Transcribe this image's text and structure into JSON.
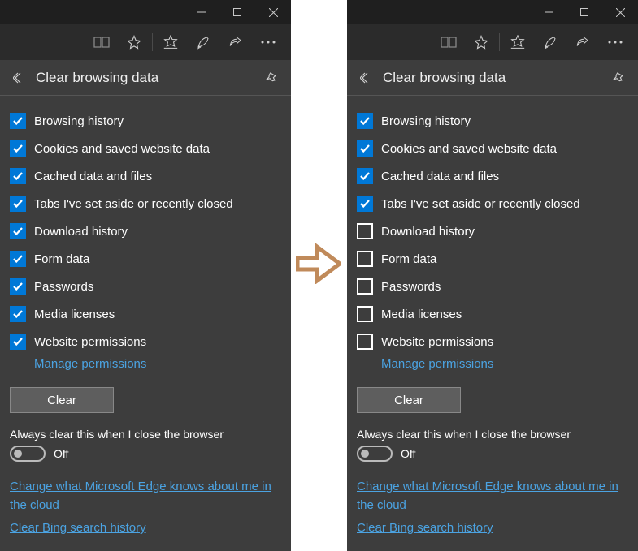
{
  "windows": [
    {
      "panel_title": "Clear browsing data",
      "checkboxes": [
        {
          "label": "Browsing history",
          "checked": true
        },
        {
          "label": "Cookies and saved website data",
          "checked": true
        },
        {
          "label": "Cached data and files",
          "checked": true
        },
        {
          "label": "Tabs I've set aside or recently closed",
          "checked": true
        },
        {
          "label": "Download history",
          "checked": true
        },
        {
          "label": "Form data",
          "checked": true
        },
        {
          "label": "Passwords",
          "checked": true
        },
        {
          "label": "Media licenses",
          "checked": true
        },
        {
          "label": "Website permissions",
          "checked": true
        }
      ],
      "manage_link": "Manage permissions",
      "clear_button": "Clear",
      "always_label": "Always clear this when I close the browser",
      "toggle_state": "Off",
      "cloud_link": "Change what Microsoft Edge knows about me in the cloud",
      "bing_link": "Clear Bing search history"
    },
    {
      "panel_title": "Clear browsing data",
      "checkboxes": [
        {
          "label": "Browsing history",
          "checked": true
        },
        {
          "label": "Cookies and saved website data",
          "checked": true
        },
        {
          "label": "Cached data and files",
          "checked": true
        },
        {
          "label": "Tabs I've set aside or recently closed",
          "checked": true
        },
        {
          "label": "Download history",
          "checked": false
        },
        {
          "label": "Form data",
          "checked": false
        },
        {
          "label": "Passwords",
          "checked": false
        },
        {
          "label": "Media licenses",
          "checked": false
        },
        {
          "label": "Website permissions",
          "checked": false
        }
      ],
      "manage_link": "Manage permissions",
      "clear_button": "Clear",
      "always_label": "Always clear this when I close the browser",
      "toggle_state": "Off",
      "cloud_link": "Change what Microsoft Edge knows about me in the cloud",
      "bing_link": "Clear Bing search history"
    }
  ]
}
